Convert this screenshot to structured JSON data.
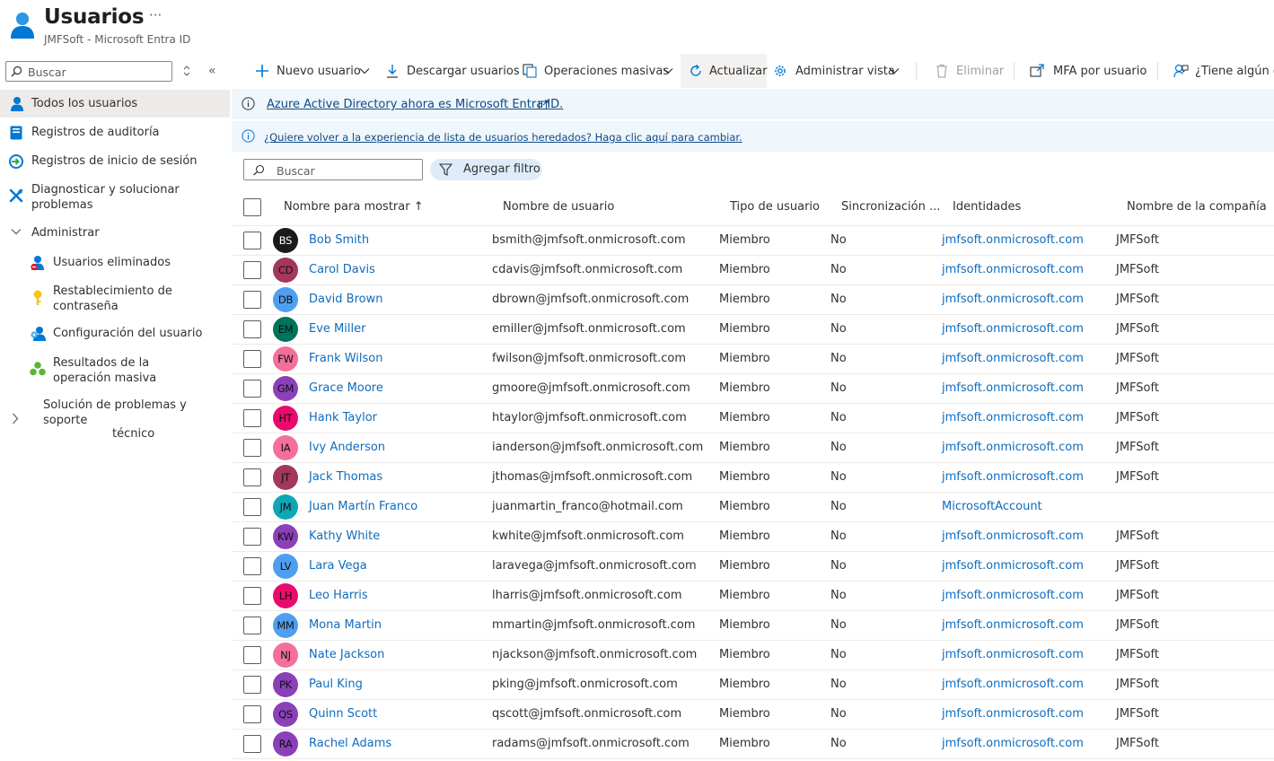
{
  "header": {
    "title": "Usuarios",
    "subtitle": "JMFSoft - Microsoft Entra ID",
    "more": "···"
  },
  "sidebar": {
    "search_placeholder": "Buscar",
    "items": [
      {
        "label": "Todos los usuarios",
        "icon": "user-icon"
      },
      {
        "label": "Registros de auditoría",
        "icon": "audit-log-icon"
      },
      {
        "label": "Registros de inicio de sesión",
        "icon": "sign-in-log-icon"
      },
      {
        "label": "Diagnosticar y solucionar problemas",
        "icon": "wrench-icon"
      },
      {
        "label": "Administrar",
        "icon": "chevron-down-icon"
      },
      {
        "label": "Usuarios eliminados",
        "icon": "deleted-user-icon"
      },
      {
        "label": "Restablecimiento de contraseña",
        "icon": "key-icon"
      },
      {
        "label": "Configuración del usuario",
        "icon": "user-settings-icon"
      },
      {
        "label": "Resultados de la operación masiva",
        "icon": "bulk-results-icon"
      },
      {
        "label_line1": "Solución de problemas y soporte",
        "label_line2": "técnico",
        "icon": "chevron-right-icon"
      }
    ]
  },
  "toolbar": {
    "new_user": "Nuevo usuario",
    "download": "Descargar usuarios",
    "bulk": "Operaciones masivas",
    "refresh": "Actualizar",
    "manage_view": "Administrar vista",
    "delete": "Eliminar",
    "mfa": "MFA por usuario",
    "feedback": "¿Tiene algún co"
  },
  "banners": {
    "entra": "Azure Active Directory ahora es Microsoft Entra ID.",
    "legacy": "¿Quiere volver a la experiencia de lista de usuarios heredados? Haga clic aquí para cambiar."
  },
  "filters": {
    "search_placeholder": "Buscar",
    "add_filter": "Agregar filtro"
  },
  "table": {
    "columns": [
      "Nombre para mostrar ↑",
      "Nombre de usuario",
      "Tipo de usuario",
      "Sincronización ...",
      "Identidades",
      "Nombre de la compañía"
    ],
    "rows": [
      {
        "initials": "BS",
        "color": "#1b1a19",
        "text_color": "#ffffff",
        "name": "Bob Smith",
        "upn": "bsmith@jmfsoft.onmicrosoft.com",
        "type": "Miembro",
        "sync": "No",
        "identity": "jmfsoft.onmicrosoft.com",
        "company": "JMFSoft"
      },
      {
        "initials": "CD",
        "color": "#a4375c",
        "text_color": "#111111",
        "name": "Carol Davis",
        "upn": "cdavis@jmfsoft.onmicrosoft.com",
        "type": "Miembro",
        "sync": "No",
        "identity": "jmfsoft.onmicrosoft.com",
        "company": "JMFSoft"
      },
      {
        "initials": "DB",
        "color": "#4f9ff0",
        "text_color": "#111111",
        "name": "David Brown",
        "upn": "dbrown@jmfsoft.onmicrosoft.com",
        "type": "Miembro",
        "sync": "No",
        "identity": "jmfsoft.onmicrosoft.com",
        "company": "JMFSoft"
      },
      {
        "initials": "EM",
        "color": "#00735c",
        "text_color": "#111111",
        "name": "Eve Miller",
        "upn": "emiller@jmfsoft.onmicrosoft.com",
        "type": "Miembro",
        "sync": "No",
        "identity": "jmfsoft.onmicrosoft.com",
        "company": "JMFSoft"
      },
      {
        "initials": "FW",
        "color": "#f46f9a",
        "text_color": "#111111",
        "name": "Frank Wilson",
        "upn": "fwilson@jmfsoft.onmicrosoft.com",
        "type": "Miembro",
        "sync": "No",
        "identity": "jmfsoft.onmicrosoft.com",
        "company": "JMFSoft"
      },
      {
        "initials": "GM",
        "color": "#8b40b8",
        "text_color": "#111111",
        "name": "Grace Moore",
        "upn": "gmoore@jmfsoft.onmicrosoft.com",
        "type": "Miembro",
        "sync": "No",
        "identity": "jmfsoft.onmicrosoft.com",
        "company": "JMFSoft"
      },
      {
        "initials": "HT",
        "color": "#ea0a6c",
        "text_color": "#111111",
        "name": "Hank Taylor",
        "upn": "htaylor@jmfsoft.onmicrosoft.com",
        "type": "Miembro",
        "sync": "No",
        "identity": "jmfsoft.onmicrosoft.com",
        "company": "JMFSoft"
      },
      {
        "initials": "IA",
        "color": "#f46f9a",
        "text_color": "#111111",
        "name": "Ivy Anderson",
        "upn": "ianderson@jmfsoft.onmicrosoft.com",
        "type": "Miembro",
        "sync": "No",
        "identity": "jmfsoft.onmicrosoft.com",
        "company": "JMFSoft"
      },
      {
        "initials": "JT",
        "color": "#a4375c",
        "text_color": "#111111",
        "name": "Jack Thomas",
        "upn": "jthomas@jmfsoft.onmicrosoft.com",
        "type": "Miembro",
        "sync": "No",
        "identity": "jmfsoft.onmicrosoft.com",
        "company": "JMFSoft"
      },
      {
        "initials": "JM",
        "color": "#0da7b5",
        "text_color": "#111111",
        "name": "Juan Martín Franco",
        "upn": "juanmartin_franco@hotmail.com",
        "type": "Miembro",
        "sync": "No",
        "identity": "MicrosoftAccount",
        "company": ""
      },
      {
        "initials": "KW",
        "color": "#8b40b8",
        "text_color": "#111111",
        "name": "Kathy White",
        "upn": "kwhite@jmfsoft.onmicrosoft.com",
        "type": "Miembro",
        "sync": "No",
        "identity": "jmfsoft.onmicrosoft.com",
        "company": "JMFSoft"
      },
      {
        "initials": "LV",
        "color": "#4f9ff0",
        "text_color": "#111111",
        "name": "Lara Vega",
        "upn": "laravega@jmfsoft.onmicrosoft.com",
        "type": "Miembro",
        "sync": "No",
        "identity": "jmfsoft.onmicrosoft.com",
        "company": "JMFSoft"
      },
      {
        "initials": "LH",
        "color": "#ea0a6c",
        "text_color": "#111111",
        "name": "Leo Harris",
        "upn": "lharris@jmfsoft.onmicrosoft.com",
        "type": "Miembro",
        "sync": "No",
        "identity": "jmfsoft.onmicrosoft.com",
        "company": "JMFSoft"
      },
      {
        "initials": "MM",
        "color": "#4f9ff0",
        "text_color": "#111111",
        "name": "Mona Martin",
        "upn": "mmartin@jmfsoft.onmicrosoft.com",
        "type": "Miembro",
        "sync": "No",
        "identity": "jmfsoft.onmicrosoft.com",
        "company": "JMFSoft"
      },
      {
        "initials": "NJ",
        "color": "#f46f9a",
        "text_color": "#111111",
        "name": "Nate Jackson",
        "upn": "njackson@jmfsoft.onmicrosoft.com",
        "type": "Miembro",
        "sync": "No",
        "identity": "jmfsoft.onmicrosoft.com",
        "company": "JMFSoft"
      },
      {
        "initials": "PK",
        "color": "#8b40b8",
        "text_color": "#111111",
        "name": "Paul King",
        "upn": "pking@jmfsoft.onmicrosoft.com",
        "type": "Miembro",
        "sync": "No",
        "identity": "jmfsoft.onmicrosoft.com",
        "company": "JMFSoft"
      },
      {
        "initials": "QS",
        "color": "#8b40b8",
        "text_color": "#111111",
        "name": "Quinn Scott",
        "upn": "qscott@jmfsoft.onmicrosoft.com",
        "type": "Miembro",
        "sync": "No",
        "identity": "jmfsoft.onmicrosoft.com",
        "company": "JMFSoft"
      },
      {
        "initials": "RA",
        "color": "#8b40b8",
        "text_color": "#111111",
        "name": "Rachel Adams",
        "upn": "radams@jmfsoft.onmicrosoft.com",
        "type": "Miembro",
        "sync": "No",
        "identity": "jmfsoft.onmicrosoft.com",
        "company": "JMFSoft"
      }
    ]
  }
}
